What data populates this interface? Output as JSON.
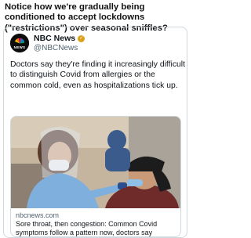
{
  "post": {
    "headline": "Notice how we're gradually being conditioned to accept lockdowns (\"restrictions\") over seasonal sniffles?"
  },
  "tweet": {
    "author_name": "NBC News",
    "author_handle": "@NBCNews",
    "avatar_label": "NEWS",
    "verified_color": "#d9a21b",
    "text": "Doctors say they're finding it increasingly difficult to distinguish Covid from allergies or the common cold, even as hospitalizations tick up."
  },
  "link_card": {
    "domain": "nbcnews.com",
    "title": "Sore throat, then congestion: Common Covid symptoms follow a pattern now, doctors say"
  }
}
